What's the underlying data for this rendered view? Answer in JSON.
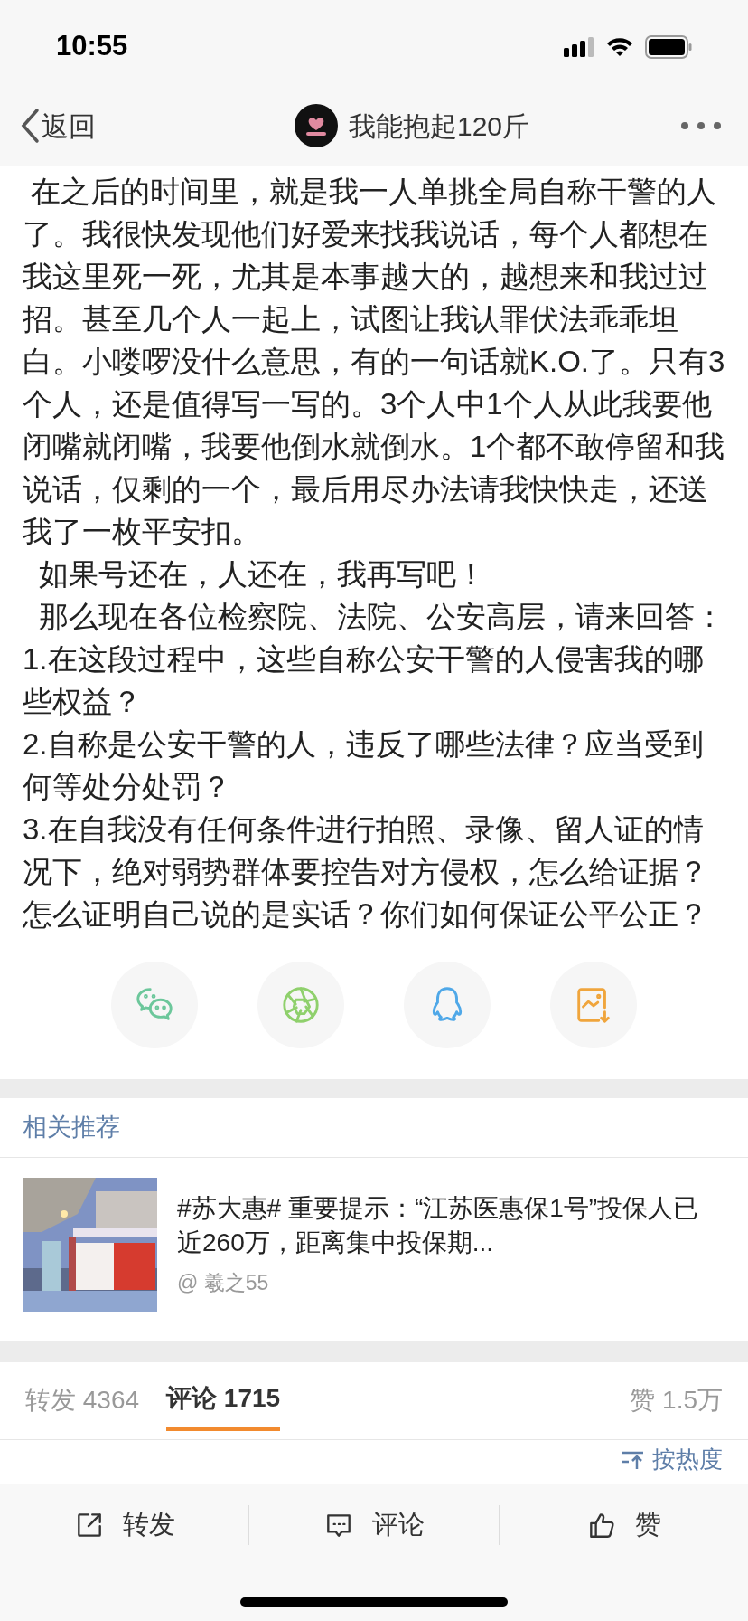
{
  "status_bar": {
    "time": "10:55"
  },
  "nav": {
    "back": "返回",
    "title": "我能抱起120斤"
  },
  "post": {
    "paragraphs": [
      " 在之后的时间里，就是我一人单挑全局自称干警的人了。我很快发现他们好爱来找我说话，每个人都想在我这里死一死，尤其是本事越大的，越想来和我过过招。甚至几个人一起上，试图让我认罪伏法乖乖坦白。小喽啰没什么意思，有的一句话就K.O.了。只有3个人，还是值得写一写的。3个人中1个人从此我要他闭嘴就闭嘴，我要他倒水就倒水。1个都不敢停留和我说话，仅剩的一个，最后用尽办法请我快快走，还送我了一枚平安扣。",
      "  如果号还在，人还在，我再写吧！",
      "  那么现在各位检察院、法院、公安高层，请来回答：",
      "1.在这段过程中，这些自称公安干警的人侵害我的哪些权益？",
      "2.自称是公安干警的人，违反了哪些法律？应当受到何等处分处罚？",
      "3.在自我没有任何条件进行拍照、录像、留人证的情况下，绝对弱势群体要控告对方侵权，怎么给证据？怎么证明自己说的是实话？你们如何保证公平公正？"
    ]
  },
  "share": [
    {
      "kind": "wechat"
    },
    {
      "kind": "moments"
    },
    {
      "kind": "qq"
    },
    {
      "kind": "save"
    }
  ],
  "related": {
    "heading": "相关推荐",
    "items": [
      {
        "title": "#苏大惠# 重要提示：“江苏医惠保1号”投保人已近260万，距离集中投保期...",
        "author": "@ 羲之55",
        "kind": "picture"
      }
    ]
  },
  "tabs": [
    {
      "label": "转发 4364",
      "selected": false
    },
    {
      "label": "评论 1715",
      "selected": true
    },
    {
      "label": "赞 1.5万",
      "selected": false
    }
  ],
  "sort": {
    "label": "按热度"
  },
  "actions": [
    {
      "kind": "repost",
      "label": "转发"
    },
    {
      "kind": "comment",
      "label": "评论"
    },
    {
      "kind": "like",
      "label": "赞"
    }
  ]
}
